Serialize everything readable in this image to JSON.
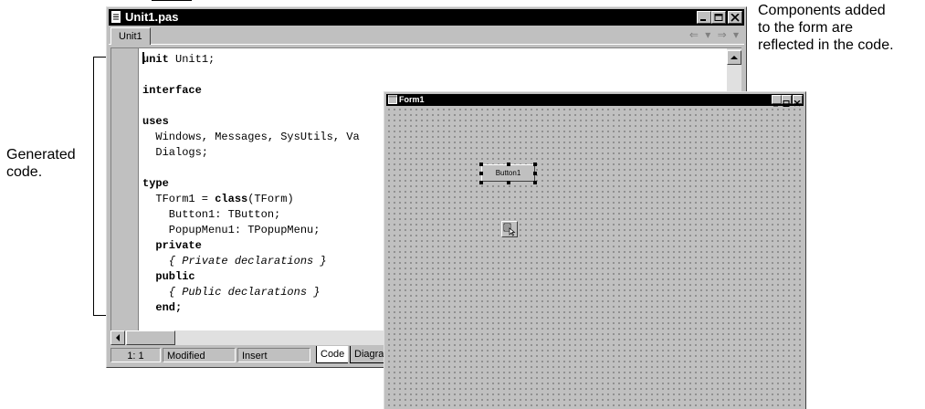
{
  "annotations": {
    "right_lines": [
      "Components added",
      "to the form are",
      "reflected in the code."
    ],
    "left_lines": [
      "Generated",
      "code."
    ]
  },
  "editor": {
    "title": "Unit1.pas",
    "tab_label": "Unit1",
    "nav_arrows": "⇐ ▾ ⇒ ▾",
    "code": {
      "l1_kw": "unit",
      "l1_rest": " Unit1;",
      "l3": "interface",
      "l5": "uses",
      "l6": "  Windows, Messages, SysUtils, Va",
      "l7": "  Dialogs;",
      "l9": "type",
      "l10_a": "  TForm1 = ",
      "l10_kw": "class",
      "l10_b": "(TForm)",
      "l11": "    Button1: TButton;",
      "l12": "    PopupMenu1: TPopupMenu;",
      "l13": "  private",
      "l14": "    { Private declarations }",
      "l15": "  public",
      "l16": "    { Public declarations }",
      "l17": "  end;"
    },
    "status": {
      "position": "1:  1",
      "modified": "Modified",
      "mode": "Insert",
      "tab_code": "Code",
      "tab_diagram": "Diagran"
    }
  },
  "form": {
    "title": "Form1",
    "button_caption": "Button1",
    "popup_icon": "popup-menu-icon"
  }
}
